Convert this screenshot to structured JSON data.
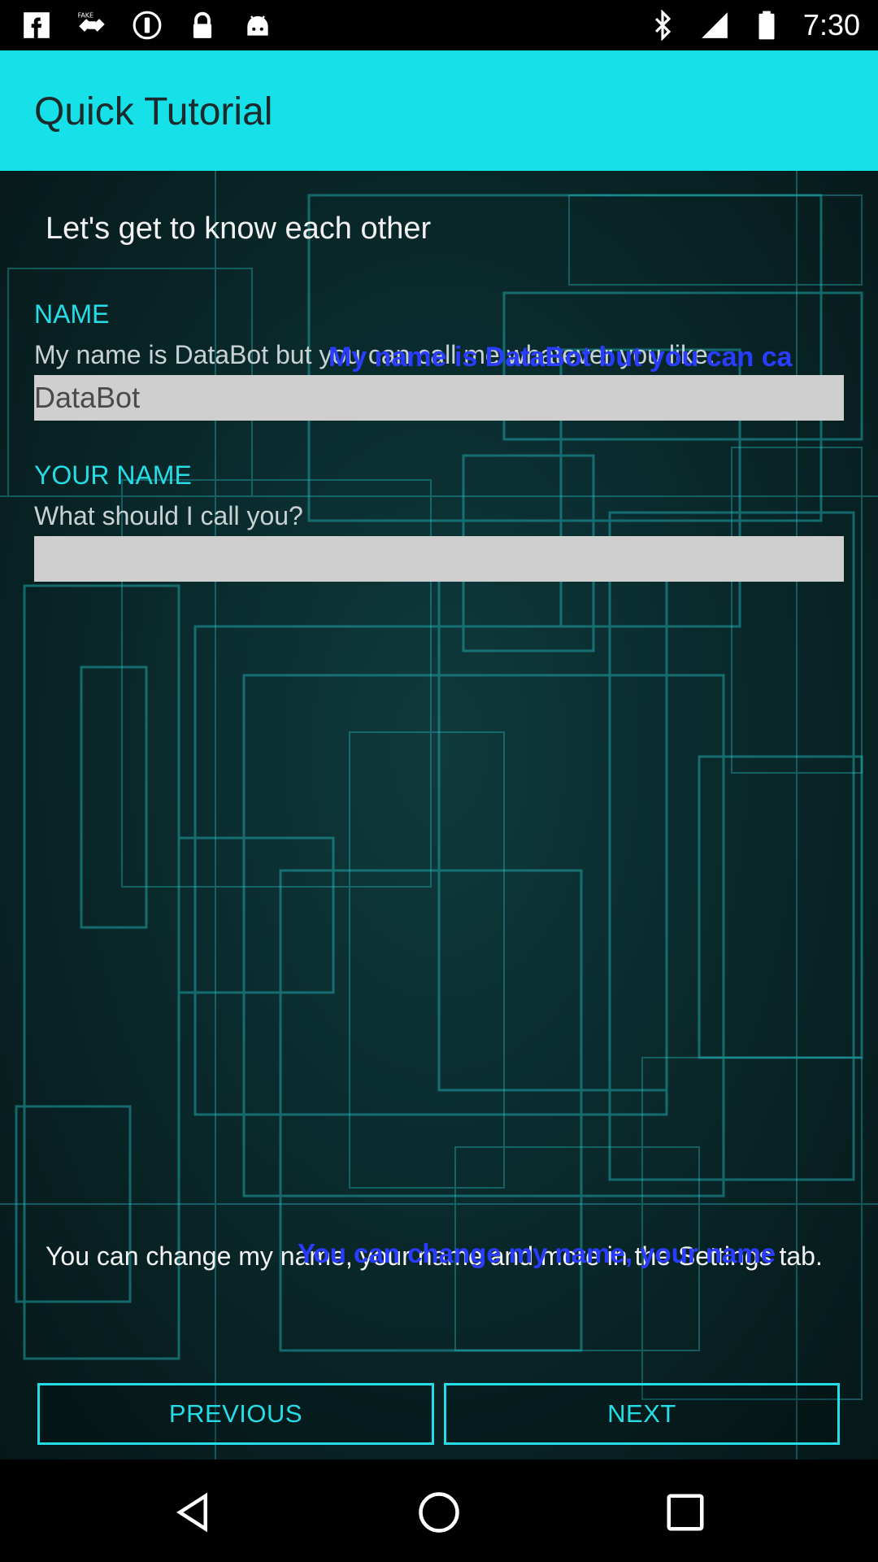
{
  "status_bar": {
    "time": "7:30",
    "left_icons": [
      "facebook-icon",
      "fake-gps-icon",
      "circle-info-icon",
      "lock-icon",
      "android-icon"
    ],
    "right_icons": [
      "bluetooth-icon",
      "signal-icon",
      "battery-icon"
    ]
  },
  "app_bar": {
    "title": "Quick Tutorial",
    "color": "#16e0e8"
  },
  "intro": "Let's get to know each other",
  "bot_name": {
    "label": "NAME",
    "help": "My name is DataBot but you can call me whatever you like.",
    "overlay": "My name is DataBot but you can ca",
    "value": "DataBot"
  },
  "user_name": {
    "label": "YOUR NAME",
    "help": "What should I call you?",
    "value": ""
  },
  "footer": {
    "note": "You can change my name, your name and more in the Settings tab.",
    "overlay": "You can change my name, your name"
  },
  "buttons": {
    "previous": "PREVIOUS",
    "next": "NEXT"
  },
  "nav_bar": {
    "icons": [
      "back-icon",
      "home-icon",
      "recents-icon"
    ]
  }
}
